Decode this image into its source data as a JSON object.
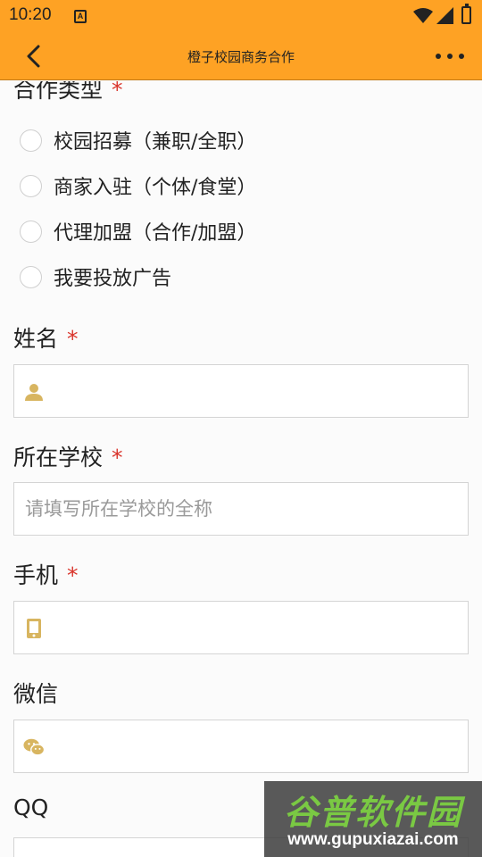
{
  "status_bar": {
    "time": "10:20",
    "notification_glyph": "A"
  },
  "app_bar": {
    "title": "橙子校园商务合作"
  },
  "form": {
    "cooperation_type": {
      "label": "合作类型",
      "required_mark": "*",
      "options": [
        "校园招募（兼职/全职）",
        "商家入驻（个体/食堂）",
        "代理加盟（合作/加盟）",
        "我要投放广告"
      ]
    },
    "name": {
      "label": "姓名",
      "required_mark": "*",
      "value": "",
      "placeholder": "",
      "icon": "person-icon"
    },
    "school": {
      "label": "所在学校",
      "required_mark": "*",
      "value": "",
      "placeholder": "请填写所在学校的全称"
    },
    "phone": {
      "label": "手机",
      "required_mark": "*",
      "value": "",
      "placeholder": "",
      "icon": "mobile-icon"
    },
    "wechat": {
      "label": "微信",
      "value": "",
      "placeholder": "",
      "icon": "wechat-icon"
    },
    "qq": {
      "label": "QQ",
      "value": "",
      "placeholder": "",
      "icon": "person-icon"
    }
  },
  "watermark": {
    "name": "谷普软件园",
    "url": "www.gupuxiazai.com"
  },
  "colors": {
    "app_bar": "#fea224",
    "required": "#d9342b",
    "icon": "#d8b560"
  }
}
